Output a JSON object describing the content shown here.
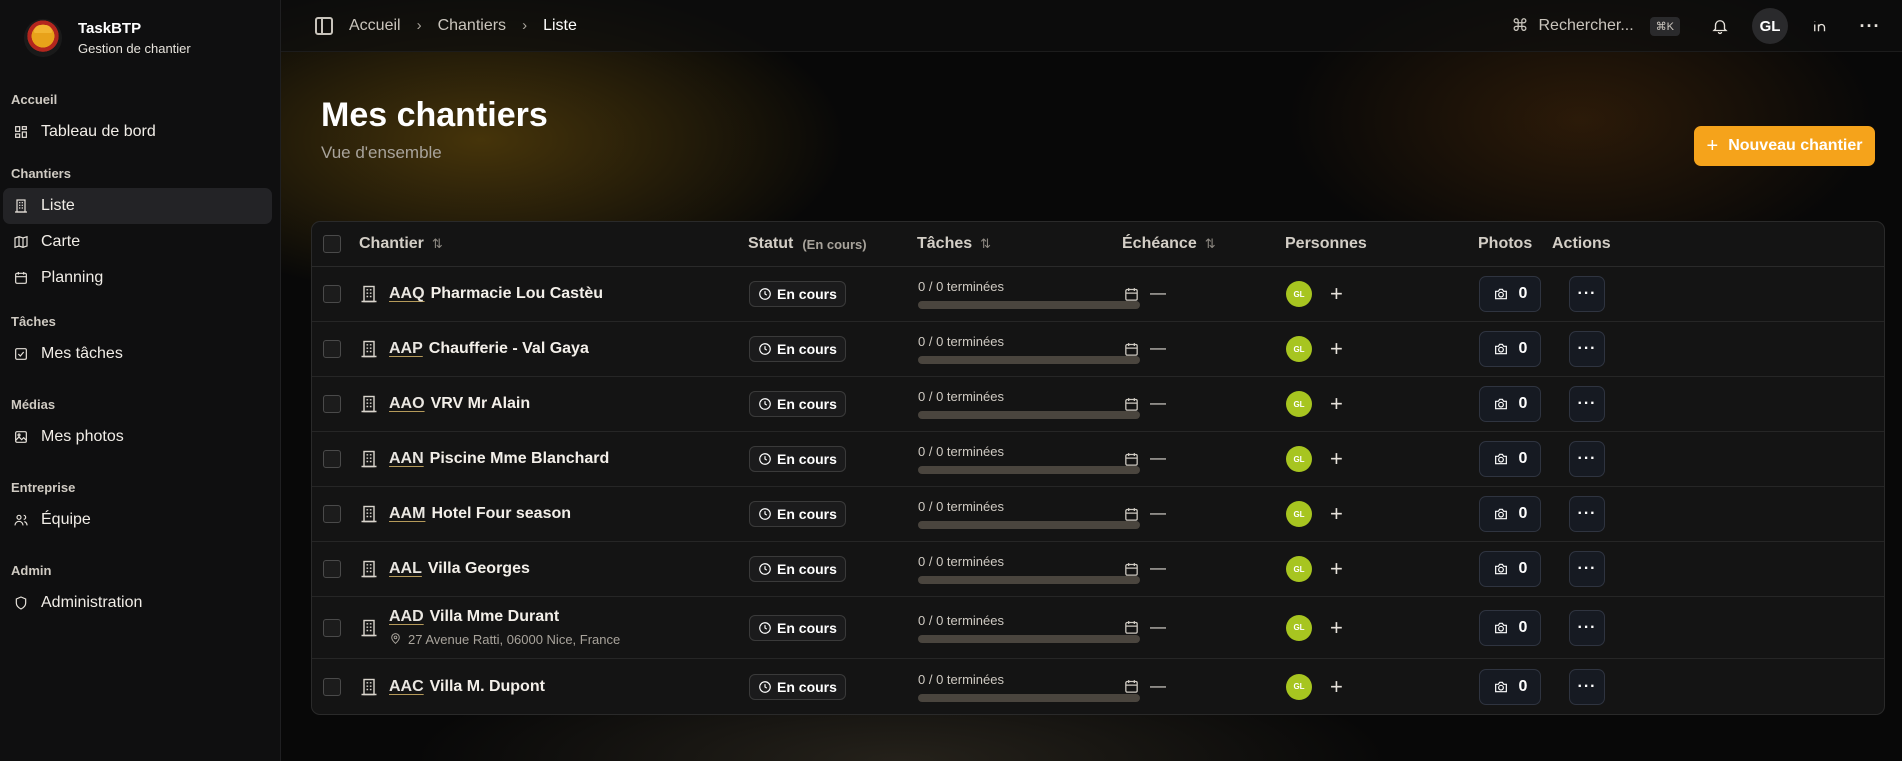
{
  "brand": {
    "title": "TaskBTP",
    "subtitle": "Gestion de chantier"
  },
  "sidebar": {
    "groups": [
      {
        "label": "Accueil",
        "items": [
          {
            "label": "Tableau de bord",
            "icon": "dashboard-icon"
          }
        ]
      },
      {
        "label": "Chantiers",
        "items": [
          {
            "label": "Liste",
            "icon": "building-icon",
            "active": true
          },
          {
            "label": "Carte",
            "icon": "map-icon"
          },
          {
            "label": "Planning",
            "icon": "calendar-icon"
          }
        ]
      },
      {
        "label": "Tâches",
        "items": [
          {
            "label": "Mes tâches",
            "icon": "checkbox-icon"
          }
        ]
      },
      {
        "label": "Médias",
        "items": [
          {
            "label": "Mes photos",
            "icon": "image-icon"
          }
        ]
      },
      {
        "label": "Entreprise",
        "items": [
          {
            "label": "Équipe",
            "icon": "users-icon"
          }
        ]
      },
      {
        "label": "Admin",
        "items": [
          {
            "label": "Administration",
            "icon": "shield-icon"
          }
        ]
      }
    ]
  },
  "topbar": {
    "breadcrumb": [
      "Accueil",
      "Chantiers",
      "Liste"
    ],
    "search_label": "Rechercher...",
    "search_shortcut": "⌘K",
    "user_initials": "GL"
  },
  "page": {
    "title": "Mes chantiers",
    "subtitle": "Vue d'ensemble",
    "new_button": "Nouveau chantier"
  },
  "table": {
    "columns": {
      "chantier": "Chantier",
      "statut": "Statut",
      "statut_filter": "(En cours)",
      "taches": "Tâches",
      "echeance": "Échéance",
      "personnes": "Personnes",
      "photos": "Photos",
      "actions": "Actions"
    },
    "rows": [
      {
        "code": "AAQ",
        "name": "Pharmacie Lou Castèu",
        "address": "",
        "status": "En cours",
        "tasks": "0 / 0 terminées",
        "progress": 0,
        "deadline": "—",
        "person": "GL",
        "photos": "0"
      },
      {
        "code": "AAP",
        "name": "Chaufferie - Val Gaya",
        "address": "",
        "status": "En cours",
        "tasks": "0 / 0 terminées",
        "progress": 0,
        "deadline": "—",
        "person": "GL",
        "photos": "0"
      },
      {
        "code": "AAO",
        "name": "VRV Mr Alain",
        "address": "",
        "status": "En cours",
        "tasks": "0 / 0 terminées",
        "progress": 0,
        "deadline": "—",
        "person": "GL",
        "photos": "0"
      },
      {
        "code": "AAN",
        "name": "Piscine Mme Blanchard",
        "address": "",
        "status": "En cours",
        "tasks": "0 / 0 terminées",
        "progress": 0,
        "deadline": "—",
        "person": "GL",
        "photos": "0"
      },
      {
        "code": "AAM",
        "name": "Hotel Four season",
        "address": "",
        "status": "En cours",
        "tasks": "0 / 0 terminées",
        "progress": 0,
        "deadline": "—",
        "person": "GL",
        "photos": "0"
      },
      {
        "code": "AAL",
        "name": "Villa Georges",
        "address": "",
        "status": "En cours",
        "tasks": "0 / 0 terminées",
        "progress": 0,
        "deadline": "—",
        "person": "GL",
        "photos": "0"
      },
      {
        "code": "AAD",
        "name": "Villa Mme Durant",
        "address": "27 Avenue Ratti, 06000 Nice, France",
        "status": "En cours",
        "tasks": "0 / 0 terminées",
        "progress": 0,
        "deadline": "—",
        "person": "GL",
        "photos": "0"
      },
      {
        "code": "AAC",
        "name": "Villa M. Dupont",
        "address": "",
        "status": "En cours",
        "tasks": "0 / 0 terminées",
        "progress": 0,
        "deadline": "—",
        "person": "GL",
        "photos": "0"
      }
    ]
  },
  "colors": {
    "accent": "#f5a31b",
    "avatar": "#a7c520",
    "background": "#080808"
  }
}
